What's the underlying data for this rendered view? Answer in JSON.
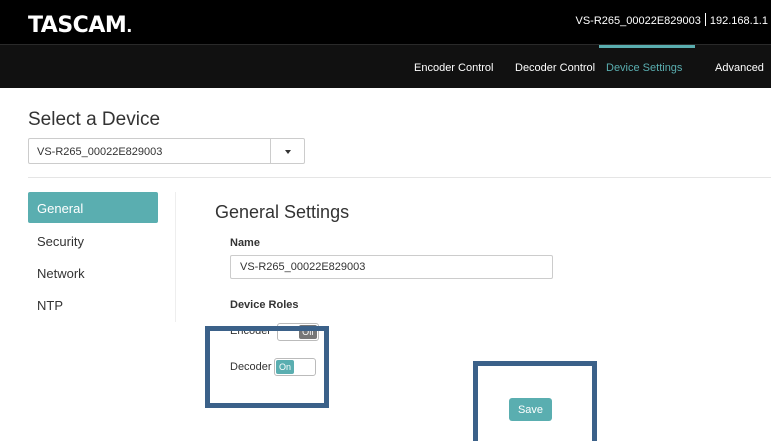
{
  "header": {
    "logo": "TASCAM",
    "logo_dot": ".",
    "device_name": "VS-R265_00022E829003",
    "device_ip": "192.168.1.1"
  },
  "nav": {
    "items": [
      {
        "label": "Encoder Control"
      },
      {
        "label": "Decoder Control"
      },
      {
        "label": "Device Settings"
      },
      {
        "label": "Advanced"
      }
    ],
    "active_index": 2
  },
  "device_select": {
    "title": "Select a Device",
    "selected": "VS-R265_00022E829003"
  },
  "sidebar": {
    "items": [
      {
        "label": "General"
      },
      {
        "label": "Security"
      },
      {
        "label": "Network"
      },
      {
        "label": "NTP"
      }
    ],
    "active_index": 0
  },
  "general": {
    "title": "General Settings",
    "name_label": "Name",
    "name_value": "VS-R265_00022E829003",
    "roles_label": "Device Roles",
    "encoder": {
      "label": "Encoder",
      "state": "Off"
    },
    "decoder": {
      "label": "Decoder",
      "state": "On"
    },
    "save_label": "Save"
  },
  "colors": {
    "accent": "#5aaeb0",
    "highlight_box": "#3b6189",
    "header_bg": "#000000"
  },
  "icons": {
    "dropdown": "caret-down-icon"
  }
}
